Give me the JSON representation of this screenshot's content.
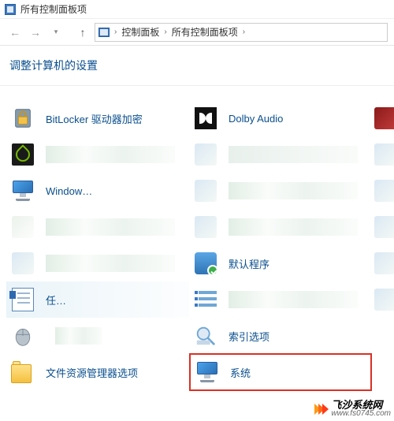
{
  "window": {
    "title": "所有控制面板项"
  },
  "nav": {
    "back_icon": "back",
    "forward_icon": "forward",
    "up_icon": "up"
  },
  "breadcrumb": {
    "items": [
      "控制面板",
      "所有控制面板项"
    ]
  },
  "subheader": {
    "text": "调整计算机的设置"
  },
  "items": {
    "bitlocker": {
      "label": "BitLocker 驱动器加密"
    },
    "dolby": {
      "label": "Dolby Audio"
    },
    "nvidia": {
      "label": ""
    },
    "blurA": {
      "label": ""
    },
    "windows": {
      "label": "Window…"
    },
    "blurB": {
      "label": ""
    },
    "blurC": {
      "label": ""
    },
    "blurD": {
      "label": ""
    },
    "blurE": {
      "label": ""
    },
    "defprog": {
      "label": "默认程序"
    },
    "tasks": {
      "label": "任…"
    },
    "blurF": {
      "label": ""
    },
    "mouse": {
      "label": ""
    },
    "index": {
      "label": "索引选项"
    },
    "folderopts": {
      "label": "文件资源管理器选项"
    },
    "system": {
      "label": "系统"
    }
  },
  "watermark": {
    "name": "飞沙系统网",
    "url": "www.fs0745.com"
  }
}
